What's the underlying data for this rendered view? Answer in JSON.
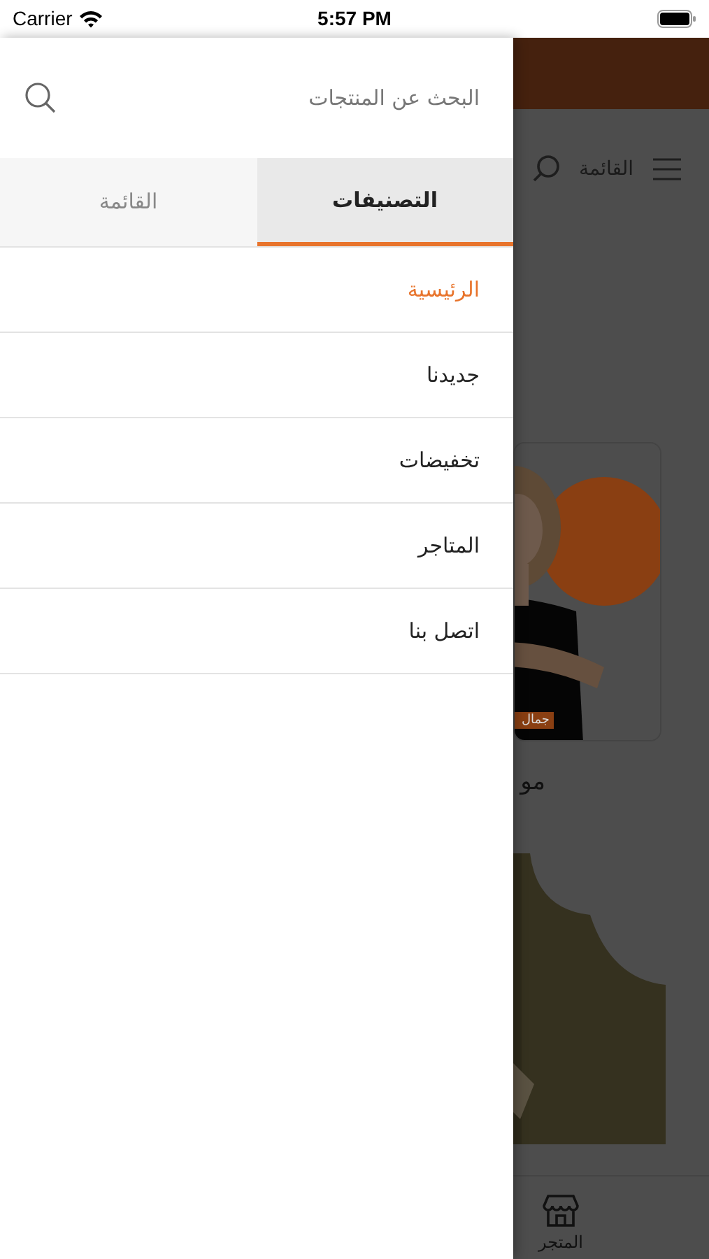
{
  "status_bar": {
    "carrier": "Carrier",
    "time": "5:57 PM"
  },
  "background": {
    "menu_label": "القائمة",
    "product_badge": "جمال",
    "product_name": "مو",
    "tab_bar": [
      {
        "label": "المتجر",
        "selected": true
      }
    ]
  },
  "drawer": {
    "search": {
      "placeholder": "البحث عن المنتجات"
    },
    "tabs": [
      {
        "label": "التصنيفات",
        "selected": true
      },
      {
        "label": "القائمة",
        "selected": false
      }
    ],
    "items": [
      {
        "label": "الرئيسية",
        "selected": true
      },
      {
        "label": "جديدنا",
        "selected": false
      },
      {
        "label": "تخفيضات",
        "selected": false
      },
      {
        "label": "المتاجر",
        "selected": false
      },
      {
        "label": "اتصل بنا",
        "selected": false
      }
    ]
  }
}
